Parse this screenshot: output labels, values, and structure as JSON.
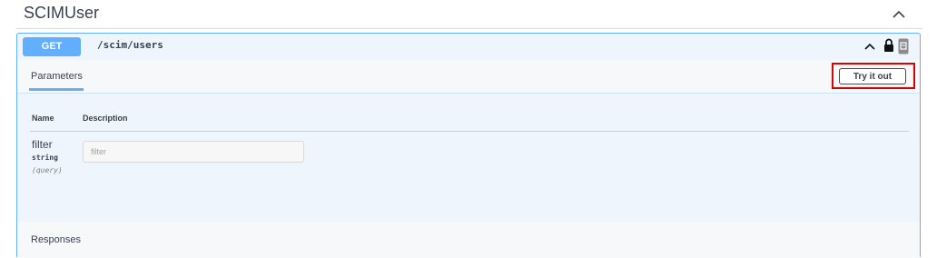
{
  "tag": {
    "title": "SCIMUser"
  },
  "operation": {
    "method": "GET",
    "path": "/scim/users",
    "colors": {
      "method_bg": "#61affe",
      "block_bg": "#eef5fd",
      "border": "#61affe"
    }
  },
  "tabs": {
    "parameters_label": "Parameters"
  },
  "actions": {
    "try_it_out_label": "Try it out",
    "highlight_color": "#dd0000"
  },
  "table": {
    "headers": {
      "name": "Name",
      "description": "Description"
    },
    "params": [
      {
        "name": "filter",
        "type": "string",
        "in": "(query)",
        "placeholder": "filter"
      }
    ]
  },
  "responses": {
    "label": "Responses"
  },
  "icons": [
    "chevron-up-icon",
    "lock-icon",
    "copy-icon"
  ]
}
